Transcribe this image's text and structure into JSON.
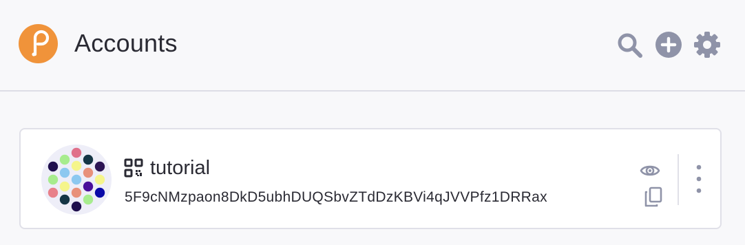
{
  "header": {
    "title": "Accounts",
    "logo_color": "#f0933a",
    "icons": [
      "search-icon",
      "add-icon",
      "settings-icon"
    ],
    "icon_color": "#8f93a8"
  },
  "account": {
    "name": "tutorial",
    "address": "5F9cNMzpaon8DkD5ubhDUQSbvZTdDzKBVi4qJVVPfz1DRRax",
    "type_icon": "qr-code-icon",
    "actions": [
      "eye-icon",
      "copy-icon",
      "more-vertical-icon"
    ]
  },
  "colors": {
    "background": "#f8f8fa",
    "card": "#ffffff",
    "text": "#2a2a33"
  }
}
